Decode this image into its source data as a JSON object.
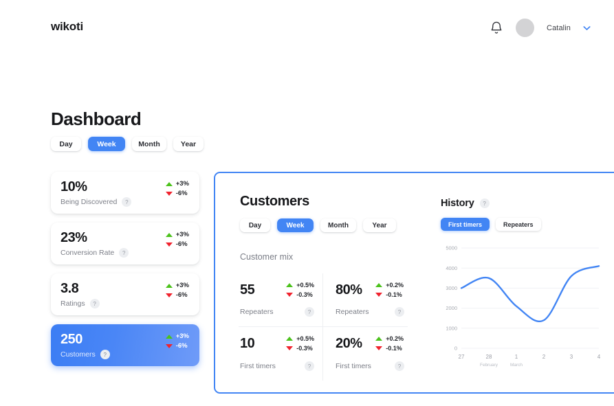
{
  "header": {
    "brand": "wikoti",
    "bell_icon": "bell-icon",
    "user_name": "Catalin",
    "chevron_icon": "chevron-down-icon",
    "accent_color": "#4285f4"
  },
  "dashboard": {
    "title": "Dashboard",
    "range_tabs": [
      {
        "label": "Day",
        "active": false
      },
      {
        "label": "Week",
        "active": true
      },
      {
        "label": "Month",
        "active": false
      },
      {
        "label": "Year",
        "active": false
      }
    ]
  },
  "kpi_cards": [
    {
      "value": "10%",
      "label": "Being Discovered",
      "help": "?",
      "up": "+3%",
      "down": "-6%",
      "selected": false
    },
    {
      "value": "23%",
      "label": "Conversion Rate",
      "help": "?",
      "up": "+3%",
      "down": "-6%",
      "selected": false
    },
    {
      "value": "3.8",
      "label": "Ratings",
      "help": "?",
      "up": "+3%",
      "down": "-6%",
      "selected": false
    },
    {
      "value": "250",
      "label": "Customers",
      "help": "?",
      "up": "+3%",
      "down": "-6%",
      "selected": true
    }
  ],
  "panel": {
    "title": "Customers",
    "border_color": "#4285f4",
    "range_tabs": [
      {
        "label": "Day",
        "active": false
      },
      {
        "label": "Week",
        "active": true
      },
      {
        "label": "Month",
        "active": false
      },
      {
        "label": "Year",
        "active": false
      }
    ],
    "mix_title": "Customer mix",
    "stats": [
      {
        "value": "55",
        "label": "Repeaters",
        "help": "?",
        "up": "+0.5%",
        "down": "-0.3%"
      },
      {
        "value": "80%",
        "label": "Repeaters",
        "help": "?",
        "up": "+0.2%",
        "down": "-0.1%"
      },
      {
        "value": "10",
        "label": "First timers",
        "help": "?",
        "up": "+0.5%",
        "down": "-0.3%"
      },
      {
        "value": "20%",
        "label": "First timers",
        "help": "?",
        "up": "+0.2%",
        "down": "-0.1%"
      }
    ]
  },
  "history": {
    "title": "History",
    "help": "?",
    "series_tabs": [
      {
        "label": "First timers",
        "active": true
      },
      {
        "label": "Repeaters",
        "active": false
      }
    ]
  },
  "colors": {
    "accent": "#4285f4",
    "line": "#4285f4",
    "up": "#4cc21c",
    "down": "#f0232e",
    "muted": "#7b7e87",
    "grid": "#f0f1f4"
  },
  "chart_data": {
    "type": "line",
    "title": "History",
    "xlabel": "",
    "ylabel": "",
    "ylim": [
      0,
      5000
    ],
    "yticks": [
      0,
      1000,
      2000,
      3000,
      4000,
      5000
    ],
    "ytick_labels": [
      "0",
      "1000",
      "2000",
      "3000",
      "4000",
      "5000"
    ],
    "grid": true,
    "legend": "First timers",
    "legend_position": "top-left",
    "x": [
      "27",
      "28",
      "1",
      "2",
      "3",
      "4"
    ],
    "x_months": [
      "",
      "February",
      "March",
      "",
      "",
      ""
    ],
    "series": [
      {
        "name": "First timers",
        "color": "#4285f4",
        "values": [
          3000,
          3500,
          2100,
          1400,
          3600,
          4100
        ]
      }
    ]
  }
}
